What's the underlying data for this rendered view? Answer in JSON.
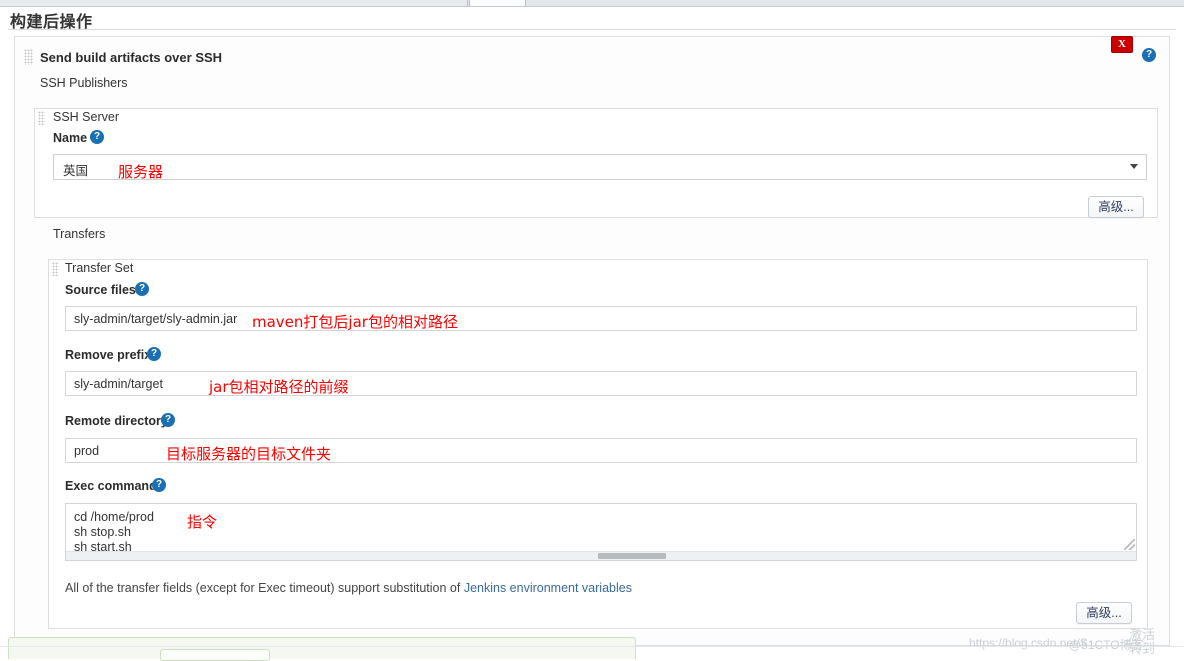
{
  "page": {
    "section_title": "构建后操作"
  },
  "block": {
    "title": "Send build artifacts over SSH",
    "publishers_label": "SSH Publishers",
    "delete_label": "X",
    "help_icon": "help-icon"
  },
  "ssh_server": {
    "legend": "SSH Server",
    "name_label": "Name",
    "selected_value": "英国",
    "advanced_label": "高级...",
    "annotation": "服务器"
  },
  "transfers": {
    "label": "Transfers",
    "transfer_set_legend": "Transfer Set",
    "fields": [
      {
        "label": "Source files",
        "value": "sly-admin/target/sly-admin.jar",
        "annotation": "maven打包后jar包的相对路径"
      },
      {
        "label": "Remove prefix",
        "value": "sly-admin/target",
        "annotation": "jar包相对路径的前缀"
      },
      {
        "label": "Remote directory",
        "value": "prod",
        "annotation": "目标服务器的目标文件夹"
      }
    ],
    "exec_command": {
      "label": "Exec command",
      "value": "cd /home/prod\nsh stop.sh\nsh start.sh",
      "annotation": "指令"
    },
    "note_text": "All of the transfer fields (except for Exec timeout) support substitution of ",
    "note_link": "Jenkins environment variables",
    "advanced_label": "高级..."
  },
  "watermark": {
    "url": "https://blog.csdn.net/S",
    "handle": "@51CTO博客",
    "activate": "激活\n转到"
  },
  "colors": {
    "accent_blue": "#1a6fb5",
    "delete_red": "#cc0000",
    "annotation_red": "#ff0000",
    "link_blue": "#3a6b9e",
    "panel_border": "#dedede"
  }
}
